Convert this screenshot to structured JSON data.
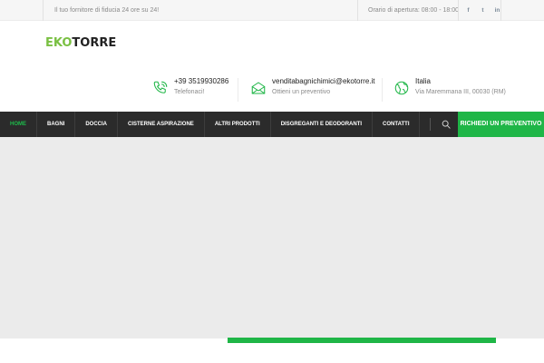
{
  "topbar": {
    "tagline": "Il tuo fornitore di fiducia 24 ore su 24!",
    "hours": "Orario di apertura: 08:00 - 18:00",
    "socials": [
      {
        "icon": "facebook-icon",
        "glyph": "f"
      },
      {
        "icon": "twitter-icon",
        "glyph": "t"
      },
      {
        "icon": "linkedin-icon",
        "glyph": "in"
      }
    ]
  },
  "logo": {
    "part1": "EKO",
    "part2": "TORRE",
    "brand_color": "#7ac043"
  },
  "contacts": [
    {
      "icon": "phone-icon",
      "main": "+39 3519930286",
      "sub": "Telefonaci!"
    },
    {
      "icon": "email-icon",
      "main": "venditabagnichimici@ekotorre.it",
      "sub": "Ottieni un preventivo"
    },
    {
      "icon": "globe-icon",
      "main": "Italia",
      "sub": "Via Maremmana III, 00030 (RM)"
    }
  ],
  "nav": {
    "items": [
      {
        "label": "Home",
        "active": true
      },
      {
        "label": "Bagni",
        "active": false
      },
      {
        "label": "Doccia",
        "active": false
      },
      {
        "label": "Cisterne Aspirazione",
        "active": false
      },
      {
        "label": "Altri prodotti",
        "active": false
      },
      {
        "label": "Disgreganti e Deodoranti",
        "active": false
      },
      {
        "label": "Contatti",
        "active": false
      }
    ],
    "cta": "Richiedi un preventivo",
    "accent": "#1fb647"
  }
}
